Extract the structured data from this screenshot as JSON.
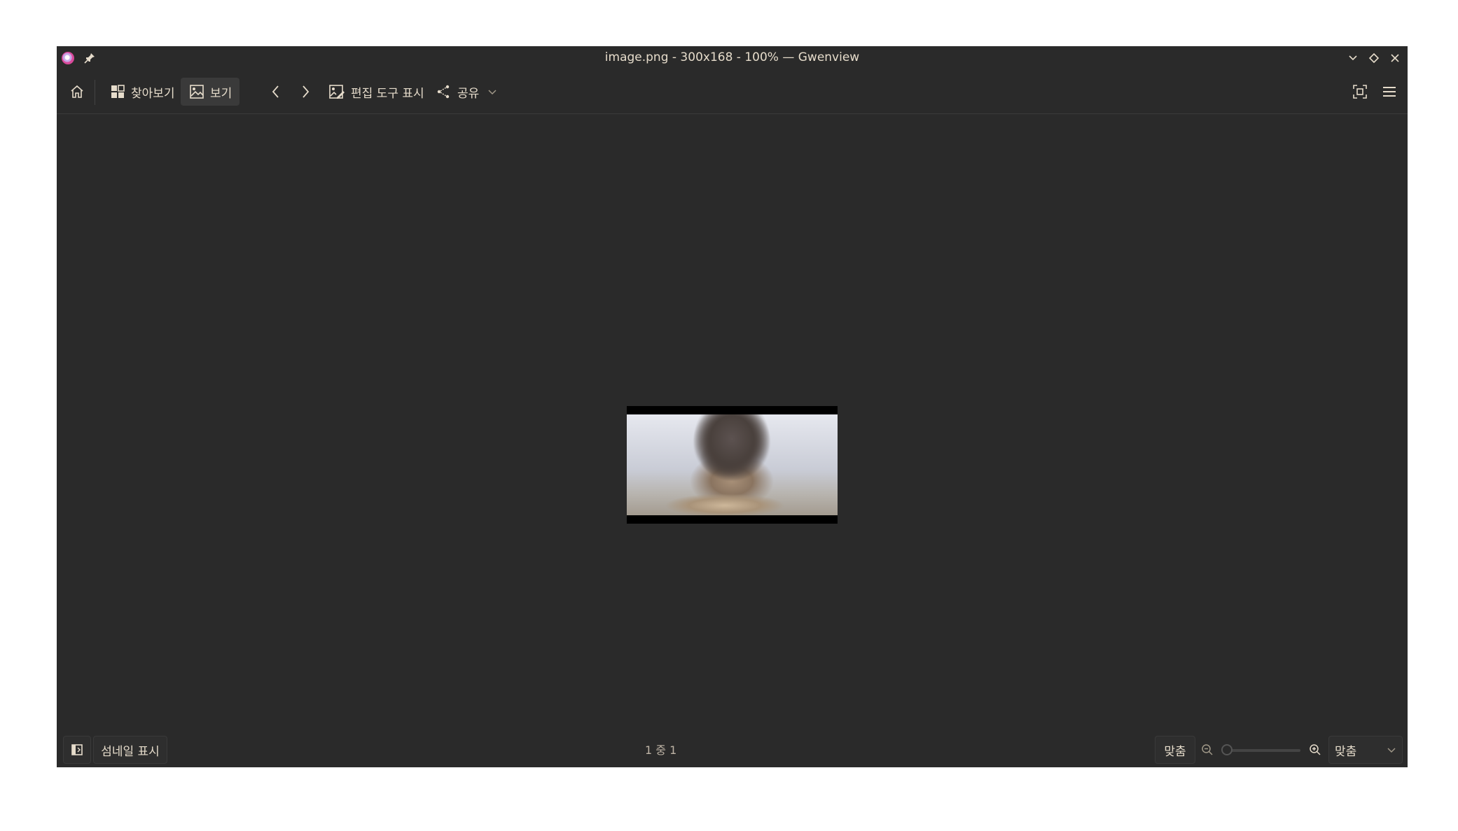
{
  "window": {
    "title": "image.png - 300x168 - 100% — Gwenview"
  },
  "toolbar": {
    "browse_label": "찾아보기",
    "view_label": "보기",
    "edit_tools_label": "편집 도구 표시",
    "share_label": "공유"
  },
  "statusbar": {
    "thumbnails_label": "섬네일 표시",
    "page_count": "1 중 1",
    "fit_button_label": "맞춤",
    "zoom_select_value": "맞춤"
  },
  "image": {
    "filename": "image.png",
    "dimensions": "300x168",
    "zoom": "100%"
  },
  "colors": {
    "background": "#2a2a2a",
    "text": "#e6dccb",
    "accent_icon": "#d94a9b"
  }
}
